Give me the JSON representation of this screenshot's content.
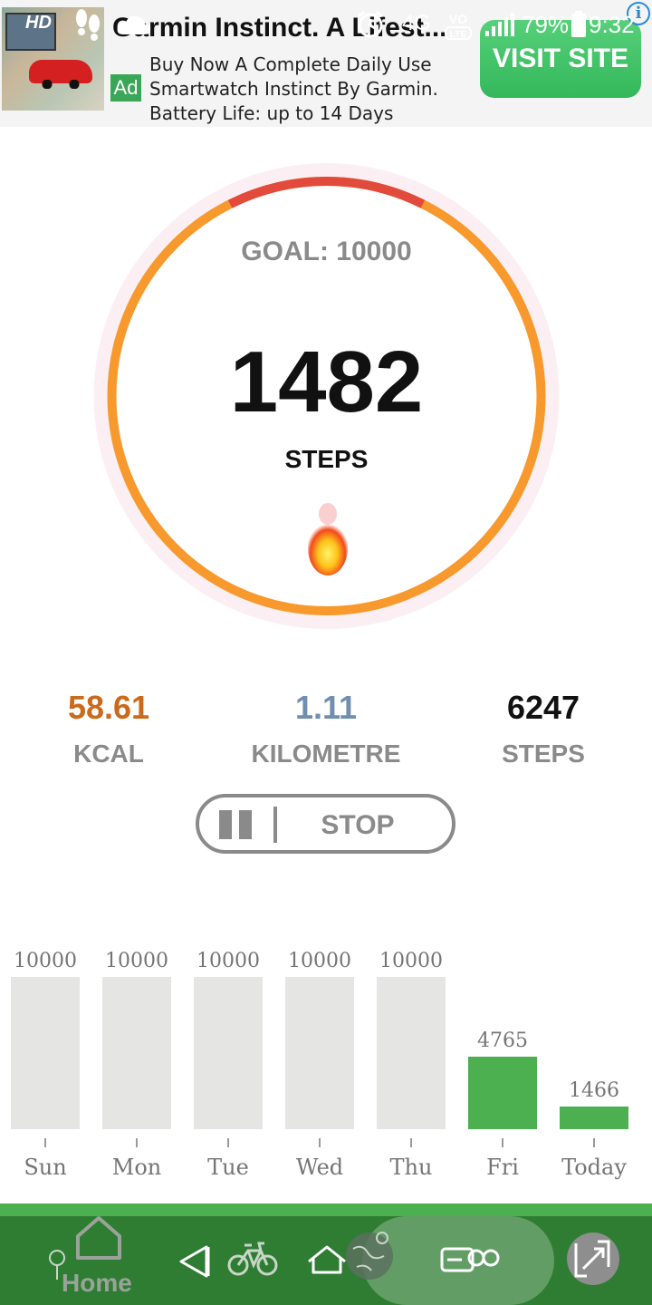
{
  "status_bar": {
    "network": "4G",
    "volte": "VoLTE",
    "battery": "79%",
    "time": "9:32"
  },
  "ad": {
    "thumb_badge": "HD",
    "title": "Garmin Instinct. A Lifest...",
    "badge": "Ad",
    "description_lines": [
      "Buy Now A Complete Daily Use",
      "Smartwatch Instinct By Garmin.",
      "Battery Life: up to 14 Days"
    ],
    "cta": "VISIT SITE",
    "info_icon": "i"
  },
  "ring": {
    "goal_label": "GOAL: 10000",
    "steps": "1482",
    "steps_label": "STEPS",
    "progress": 0.1482,
    "colors": {
      "track": "#fbeff3",
      "progress": "#e24a3b",
      "remaining": "#f7992c"
    }
  },
  "stats": {
    "kcal": {
      "value": "58.61",
      "label": "KCAL",
      "color": "#cc6a1b"
    },
    "distance": {
      "value": "1.11",
      "label": "KILOMETRE",
      "color": "#6e8fb0"
    },
    "steps": {
      "value": "6247",
      "label": "STEPS",
      "color": "#111111"
    }
  },
  "controls": {
    "stop_label": "STOP"
  },
  "chart_data": {
    "type": "bar",
    "categories": [
      "Sun",
      "Mon",
      "Tue",
      "Wed",
      "Thu",
      "Fri",
      "Today"
    ],
    "values": [
      10000,
      10000,
      10000,
      10000,
      10000,
      4765,
      1466
    ],
    "labels": [
      "10000",
      "10000",
      "10000",
      "10000",
      "10000",
      "4765",
      "1466"
    ],
    "active": [
      false,
      false,
      false,
      false,
      false,
      true,
      true
    ],
    "ylim": [
      0,
      10000
    ],
    "colors": {
      "goal_met": "#e5e6e4",
      "in_progress": "#4caf50"
    }
  },
  "nav": {
    "home_label": "Home"
  }
}
